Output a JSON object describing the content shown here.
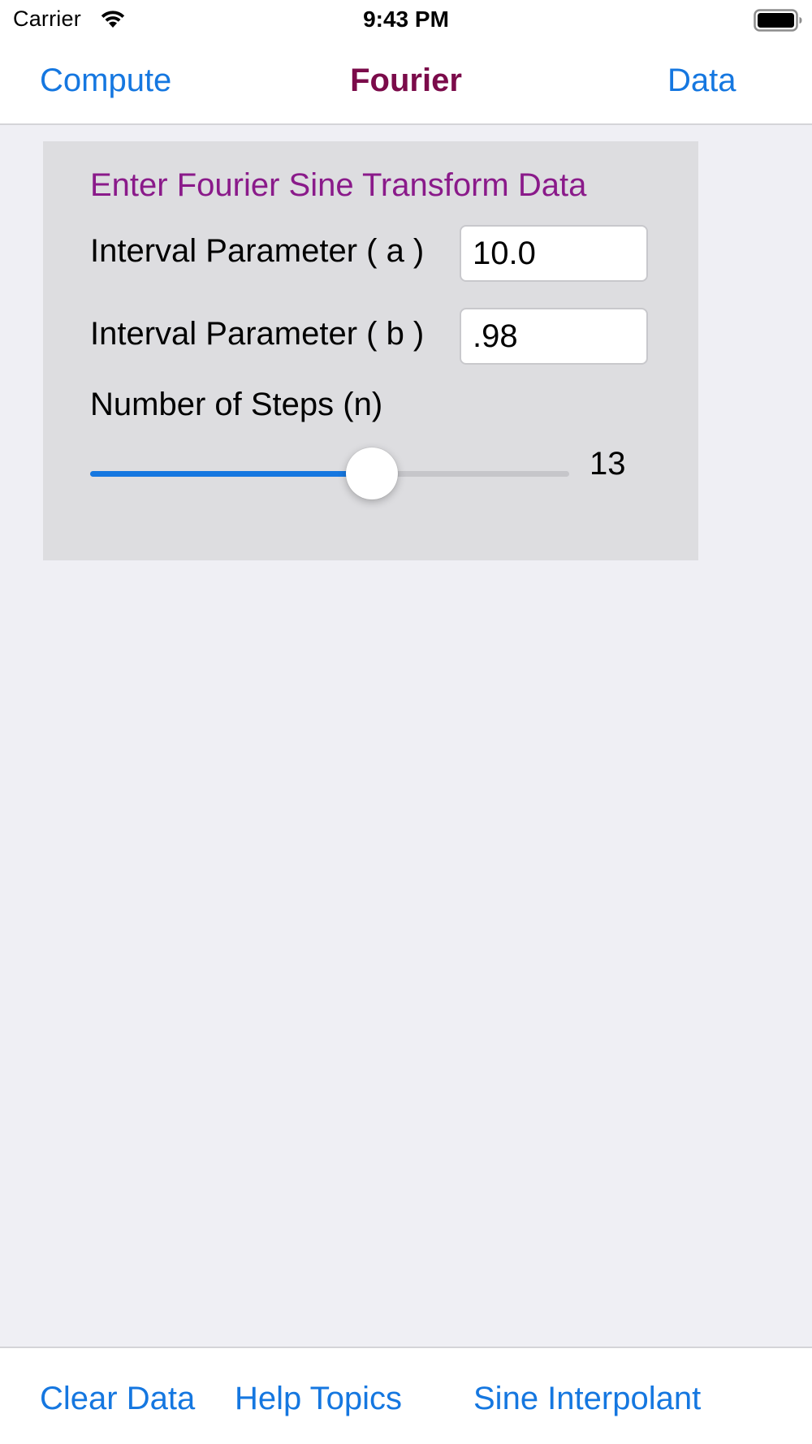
{
  "status_bar": {
    "carrier": "Carrier",
    "time": "9:43 PM",
    "wifi_icon": "wifi-icon",
    "battery_icon": "battery-full-icon"
  },
  "nav": {
    "left_button": "Compute",
    "title": "Fourier",
    "right_button": "Data"
  },
  "panel": {
    "title": "Enter Fourier Sine Transform Data",
    "field_a": {
      "label": "Interval Parameter ( a )",
      "value": "10.0"
    },
    "field_b": {
      "label": "Interval Parameter ( b )",
      "value": ".98"
    },
    "steps": {
      "label": "Number of Steps (n)",
      "value": "13",
      "fill_fraction": 0.588
    }
  },
  "toolbar": {
    "clear_data": "Clear Data",
    "help_topics": "Help Topics",
    "sine_interpolant": "Sine Interpolant"
  },
  "colors": {
    "accent": "#1577e0",
    "title": "#7b0b4a",
    "panel_title": "#8a1a8a",
    "background": "#efeff4",
    "panel": "#dddde0"
  }
}
